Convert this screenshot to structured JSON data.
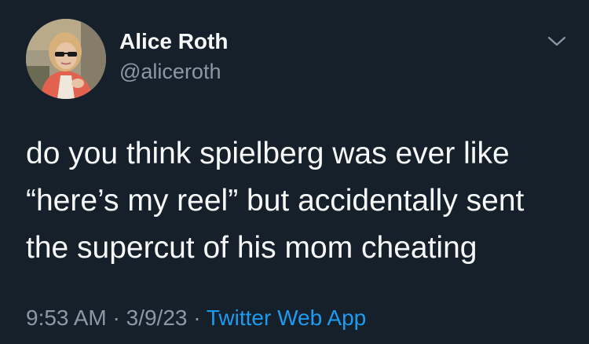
{
  "author": {
    "display_name": "Alice Roth",
    "handle": "@aliceroth"
  },
  "tweet": {
    "lines": [
      "do you think spielberg was ever like",
      "“here’s my reel” but accidentally sent",
      "the supercut of his mom cheating"
    ]
  },
  "meta": {
    "time": "9:53 AM",
    "separator_1": " · ",
    "date": "3/9/23",
    "separator_2": " · ",
    "source": "Twitter Web App"
  },
  "icons": {
    "more_menu": "chevron-down-icon"
  },
  "colors": {
    "background": "#15202b",
    "primary_text": "#f7f9f9",
    "secondary_text": "#8b98a5",
    "link": "#1d9bf0"
  }
}
